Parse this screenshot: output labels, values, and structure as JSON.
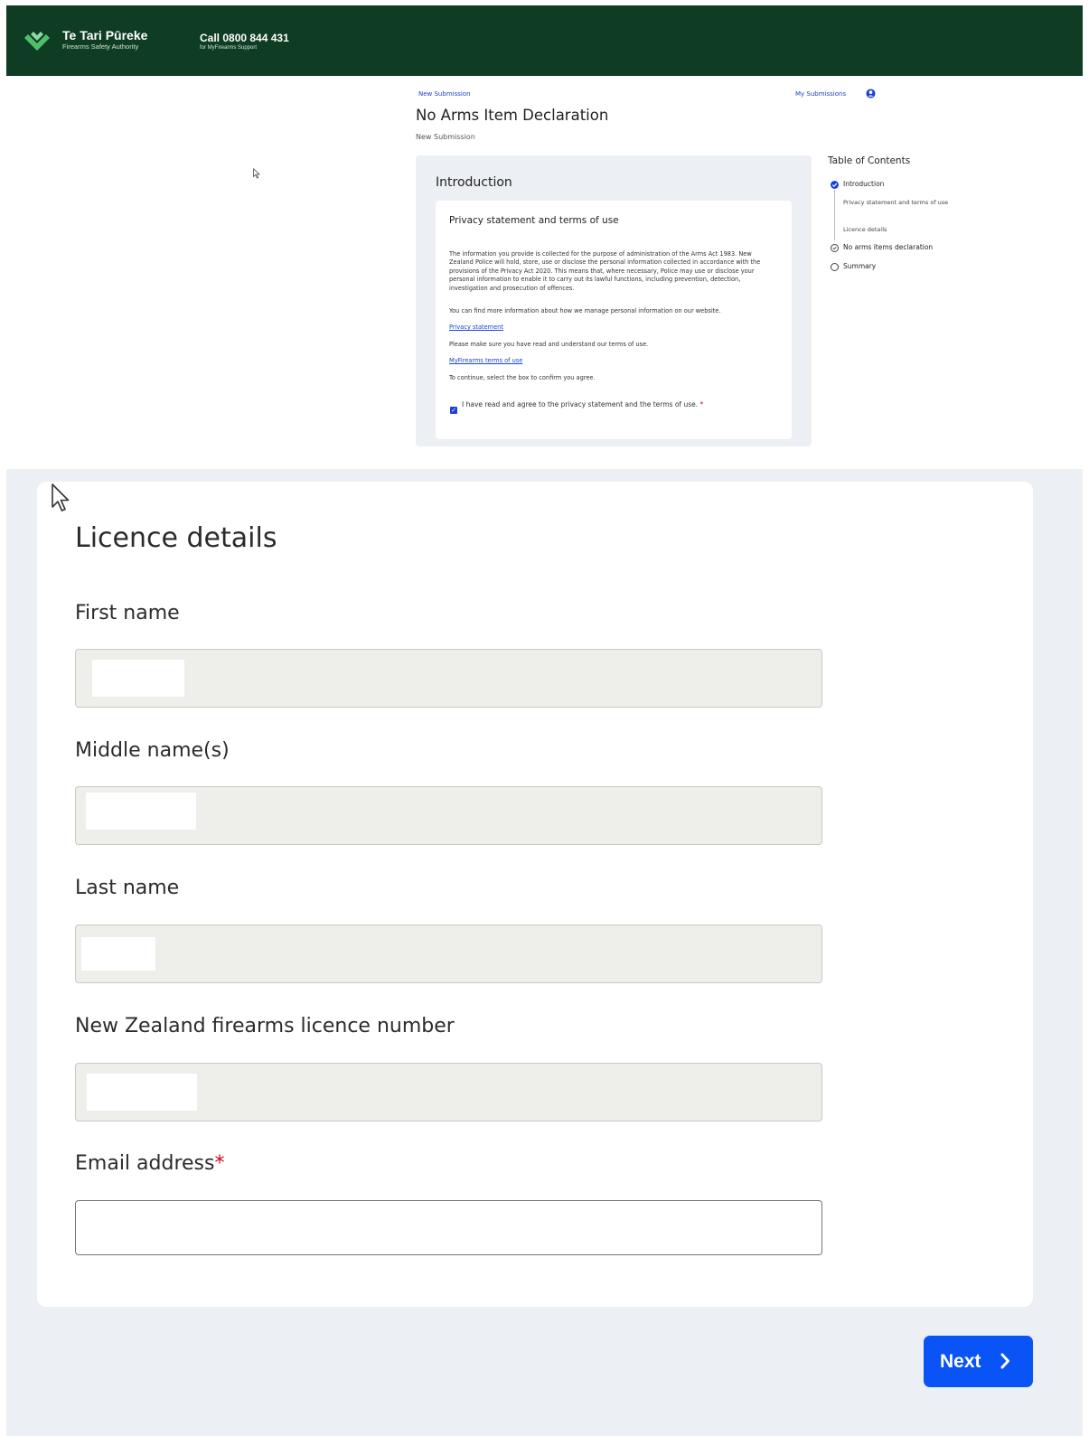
{
  "header": {
    "brand_title": "Te Tari Pūreke",
    "brand_sub": "Firearms Safety Authority",
    "call_title": "Call 0800 844 431",
    "call_sub": "for MyFirearms Support"
  },
  "nav": {
    "new_submission": "New Submission",
    "my_submissions": "My Submissions"
  },
  "page": {
    "title": "No Arms Item Declaration",
    "subtitle": "New Submission"
  },
  "intro": {
    "section_title": "Introduction",
    "card_title": "Privacy statement and terms of use",
    "para1": "The information you provide is collected for the purpose of administration of the Arms Act 1983. New Zealand Police will hold, store, use or disclose the personal information collected in accordance with the provisions of the Privacy Act 2020. This means that, where necessary, Police may use or disclose your personal information to enable it to carry out its lawful functions, including prevention, detection, investigation and prosecution of offences.",
    "para2": "You can find more information about how we manage personal information on our website.",
    "privacy_link": "Privacy statement",
    "para3": "Please make sure you have read and understand our terms of use.",
    "terms_link": "MyFirearms terms of use",
    "para4": "To continue, select the box to confirm you agree.",
    "agree_label": "I have read and agree to the privacy statement and the terms of use.",
    "required_mark": "*",
    "agree_checked": true
  },
  "toc": {
    "title": "Table of Contents",
    "items": [
      {
        "label": "Introduction",
        "state": "complete"
      },
      {
        "label": "Privacy statement and terms of use",
        "state": "sub"
      },
      {
        "label": "Licence details",
        "state": "sub"
      },
      {
        "label": "No arms items declaration",
        "state": "pending"
      },
      {
        "label": "Summary",
        "state": "empty"
      }
    ]
  },
  "licence": {
    "title": "Licence details",
    "first_name_label": "First name",
    "middle_name_label": "Middle name(s)",
    "last_name_label": "Last name",
    "licence_number_label": "New Zealand firearms licence number",
    "email_label": "Email address",
    "required_mark": "*",
    "email_value": ""
  },
  "actions": {
    "next_label": "Next"
  },
  "colors": {
    "header_bg": "#0f3d23",
    "accent_blue": "#0a53f7",
    "link_blue": "#1a43d6",
    "required_red": "#d0021b",
    "panel_bg": "#eceff3"
  },
  "icons": [
    "firearms-authority-logo",
    "user-icon",
    "check-circle-icon",
    "pending-circle-icon",
    "empty-circle-icon",
    "checkbox-checked-icon",
    "chevron-right-icon",
    "mouse-cursor-icon"
  ]
}
